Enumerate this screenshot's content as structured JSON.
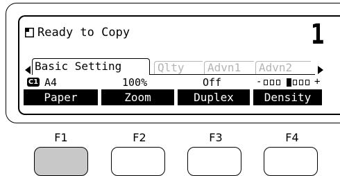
{
  "status": {
    "icon": "document-icon",
    "text": "Ready to Copy",
    "copies": "1"
  },
  "tabs": [
    {
      "label": "Basic Setting",
      "active": true
    },
    {
      "label": "Qlty",
      "active": false
    },
    {
      "label": "Advn1",
      "active": false
    },
    {
      "label": "Advn2",
      "active": false
    }
  ],
  "values": {
    "paper_source_badge": "C1",
    "paper": "A4",
    "zoom": "100%",
    "duplex": "Off",
    "density": {
      "minus_sign": "-",
      "plus_sign": "+",
      "level": 4,
      "cells": 7
    }
  },
  "function_labels": [
    "Paper",
    "Zoom",
    "Duplex",
    "Density"
  ],
  "keys": [
    {
      "label": "F1",
      "pressed": true
    },
    {
      "label": "F2",
      "pressed": false
    },
    {
      "label": "F3",
      "pressed": false
    },
    {
      "label": "F4",
      "pressed": false
    }
  ]
}
